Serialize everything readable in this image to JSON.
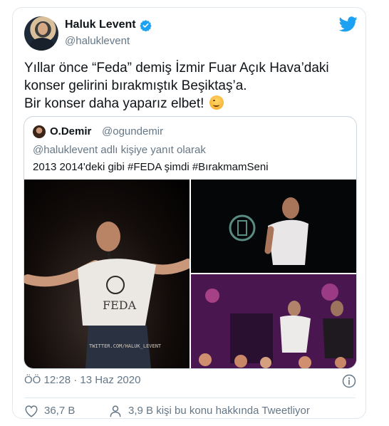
{
  "author": {
    "name": "Haluk Levent",
    "handle": "@haluklevent",
    "verified": true
  },
  "tweet": {
    "lines": [
      "Yıllar önce “Feda” demiş İzmir Fuar Açık Hava’daki",
      "konser gelirini bırakmıştık Beşiktaş’a.",
      "Bir konser daha yaparız elbet!"
    ],
    "emoji": "smiling-face-icon"
  },
  "quoted": {
    "name": "O.Demir",
    "handle": "@ogundemir",
    "reply_to": "@haluklevent adlı kişiye yanıt olarak",
    "text": "2013 2014'deki gibi #FEDA şimdi #BırakmamSeni",
    "watermark": "TWITTER.COM/HALUK_LEVENT"
  },
  "footer": {
    "time": "ÖÖ 12:28 · 13 Haz 2020",
    "likes": "36,7 B",
    "talking": "3,9 B kişi bu konu hakkında Tweetliyor"
  },
  "colors": {
    "brand": "#1da1f2",
    "secondary_text": "#657786",
    "border": "#e1e8ed"
  },
  "icons": [
    "verified-badge-icon",
    "twitter-bird-icon",
    "info-icon",
    "heart-icon",
    "person-icon"
  ]
}
